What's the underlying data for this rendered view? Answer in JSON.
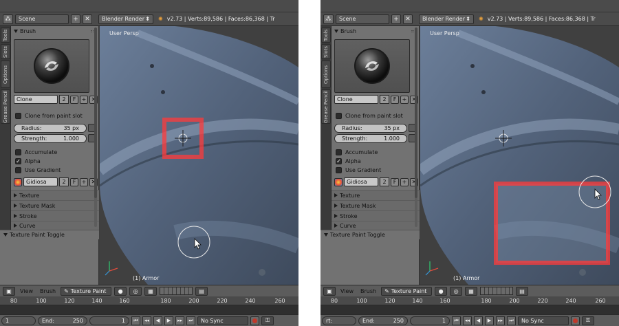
{
  "colors": {
    "panel_bg": "#727272",
    "viewport_bg": "#3f3f3f",
    "highlight": "#ff3b3b",
    "separator": "#ffffff"
  },
  "panels": [
    {
      "id": "left",
      "header": {
        "scene": "Scene",
        "renderer": "Blender Render",
        "stats": "v2.73 | Verts:89,586 | Faces:86,368 | Tr"
      },
      "tabs": [
        "Tools",
        "Slots",
        "Options",
        "Grease Pencil"
      ],
      "brush": {
        "panel_title": "Brush",
        "name": "Clone",
        "users": "2",
        "fake_user": "F",
        "clone_from_slot": "Clone from paint slot",
        "radius_label": "Radius:",
        "radius_value": "35 px",
        "strength_label": "Strength:",
        "strength_value": "1.000",
        "accumulate": "Accumulate",
        "alpha": "Alpha",
        "use_gradient": "Use Gradient",
        "palette_name": "Gidiosa",
        "palette_users": "2",
        "palette_fake": "F"
      },
      "collapsed_panels": [
        "Texture",
        "Texture Mask",
        "Stroke",
        "Curve"
      ],
      "toggle_panel": "Texture Paint Toggle",
      "viewport": {
        "view_label": "User Persp",
        "object_label": "(1) Armor"
      },
      "view_header": {
        "menus": [
          "View",
          "Brush"
        ],
        "mode": "Texture Paint"
      },
      "timeline": {
        "ticks": [
          "80",
          "100",
          "120",
          "140",
          "160",
          "180",
          "200",
          "220",
          "240",
          "260"
        ]
      },
      "footer": {
        "start": "1",
        "end_label": "End:",
        "end": "250",
        "current": "1",
        "sync": "No Sync"
      }
    },
    {
      "id": "right",
      "header": {
        "scene": "Scene",
        "renderer": "Blender Render",
        "stats": "v2.73 | Verts:89,586 | Faces:86,368 | Tr"
      },
      "tabs": [
        "Tools",
        "Slots",
        "Options",
        "Grease Pencil"
      ],
      "brush": {
        "panel_title": "Brush",
        "name": "Clone",
        "users": "2",
        "fake_user": "F",
        "clone_from_slot": "Clone from paint slot",
        "radius_label": "Radius:",
        "radius_value": "35 px",
        "strength_label": "Strength:",
        "strength_value": "1.000",
        "accumulate": "Accumulate",
        "alpha": "Alpha",
        "use_gradient": "Use Gradient",
        "palette_name": "Gidiosa",
        "palette_users": "2",
        "palette_fake": "F"
      },
      "collapsed_panels": [
        "Texture",
        "Texture Mask",
        "Stroke",
        "Curve"
      ],
      "toggle_panel": "Texture Paint Toggle",
      "viewport": {
        "view_label": "User Persp",
        "object_label": "(1) Armor"
      },
      "view_header": {
        "menus": [
          "View",
          "Brush"
        ],
        "mode": "Texture Paint"
      },
      "timeline": {
        "ticks": [
          "80",
          "100",
          "120",
          "140",
          "160",
          "180",
          "200",
          "220",
          "240",
          "260"
        ]
      },
      "footer": {
        "start": "rt:",
        "end_label": "End:",
        "end": "250",
        "current": "1",
        "sync": "No Sync"
      }
    }
  ]
}
